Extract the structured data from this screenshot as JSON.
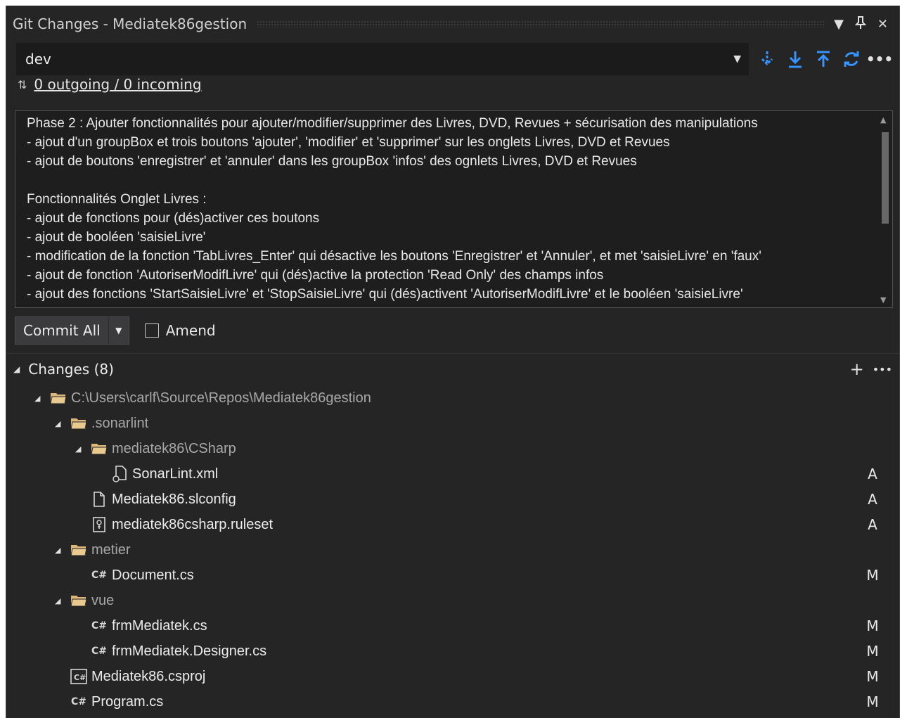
{
  "window": {
    "title": "Git Changes - Mediatek86gestion",
    "buttons": [
      "▼",
      "📌",
      "✕"
    ]
  },
  "branch": {
    "name": "dev",
    "actions": [
      "fetch-icon",
      "pull-icon",
      "push-icon",
      "sync-icon",
      "more-icon"
    ]
  },
  "sync": {
    "icon": "⇅",
    "text": "0 outgoing / 0 incoming"
  },
  "commit_message": {
    "lines": [
      "Phase 2 : Ajouter fonctionnalités pour ajouter/modifier/supprimer des Livres, DVD, Revues + sécurisation des manipulations",
      "- ajout d'un groupBox et trois boutons 'ajouter', 'modifier' et 'supprimer' sur les onglets Livres, DVD et Revues",
      "- ajout de boutons 'enregistrer' et 'annuler' dans les groupBox 'infos' des ognlets Livres, DVD et Revues",
      "",
      "Fonctionnalités Onglet Livres :",
      "- ajout de fonctions pour (dés)activer ces boutons",
      "- ajout de booléen 'saisieLivre'",
      "- modification de la fonction 'TabLivres_Enter' qui désactive les boutons 'Enregistrer' et 'Annuler', et met 'saisieLivre' en 'faux'",
      "- ajout de fonction 'AutoriserModifLivre' qui (dés)active la protection 'Read Only' des champs infos",
      "- ajout des fonctions 'StartSaisieLivre' et 'StopSaisieLivre' qui (dés)activent 'AutoriserModifLivre' et le booléen 'saisieLivre'"
    ]
  },
  "commit": {
    "button_label": "Commit All",
    "amend_label": "Amend",
    "amend_checked": false
  },
  "changes": {
    "header": "Changes (8)",
    "tree": [
      {
        "label": "C:\\Users\\carlf\\Source\\Repos\\Mediatek86gestion",
        "type": "folder",
        "depth": 0,
        "status": ""
      },
      {
        "label": ".sonarlint",
        "type": "folder",
        "depth": 1,
        "status": ""
      },
      {
        "label": "mediatek86\\CSharp",
        "type": "folder",
        "depth": 2,
        "status": ""
      },
      {
        "label": "SonarLint.xml",
        "type": "xml-file",
        "depth": 3,
        "status": "A"
      },
      {
        "label": "Mediatek86.slconfig",
        "type": "file",
        "depth": 2,
        "status": "A"
      },
      {
        "label": "mediatek86csharp.ruleset",
        "type": "ruleset-file",
        "depth": 2,
        "status": "A"
      },
      {
        "label": "metier",
        "type": "folder",
        "depth": 1,
        "status": ""
      },
      {
        "label": "Document.cs",
        "type": "cs-file",
        "depth": 2,
        "status": "M"
      },
      {
        "label": "vue",
        "type": "folder",
        "depth": 1,
        "status": ""
      },
      {
        "label": "frmMediatek.cs",
        "type": "cs-file",
        "depth": 2,
        "status": "M"
      },
      {
        "label": "frmMediatek.Designer.cs",
        "type": "cs-file",
        "depth": 2,
        "status": "M"
      },
      {
        "label": "Mediatek86.csproj",
        "type": "csproj-file",
        "depth": 1,
        "status": "M"
      },
      {
        "label": "Program.cs",
        "type": "cs-file",
        "depth": 1,
        "status": "M"
      }
    ]
  },
  "colors": {
    "accent": "#3794ff",
    "folder": "#dcb67a",
    "background": "#252526"
  }
}
